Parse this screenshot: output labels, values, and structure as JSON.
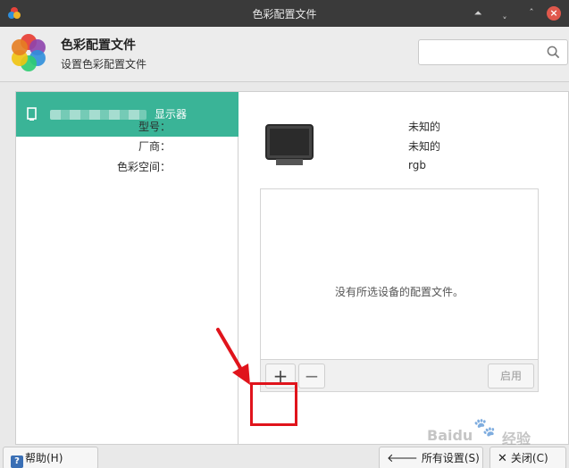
{
  "window": {
    "title": "色彩配置文件"
  },
  "header": {
    "title": "色彩配置文件",
    "subtitle": "设置色彩配置文件"
  },
  "search": {
    "placeholder": "",
    "value": ""
  },
  "devices": [
    {
      "label": "显示器",
      "selected": true
    }
  ],
  "details": {
    "fields": [
      {
        "key": "型号：",
        "value": "未知的"
      },
      {
        "key": "厂商：",
        "value": "未知的"
      },
      {
        "key": "色彩空间：",
        "value": "rgb"
      }
    ],
    "empty_message": "没有所选设备的配置文件。",
    "toolbar": {
      "add_label": "+",
      "remove_label": "−",
      "enable_label": "启用"
    }
  },
  "footer": {
    "help_label": "帮助(H)",
    "help_icon_text": "?",
    "all_settings_label": "所有设置(S)",
    "close_label": "关闭(C)"
  },
  "watermark": {
    "text": "Baidu",
    "suffix": "经验"
  },
  "colors": {
    "accent": "#3ab497",
    "highlight": "#e0141c",
    "titlebar": "#3a3a3a"
  },
  "icons": [
    "app-icon",
    "shade-icon",
    "minimize-icon",
    "maximize-icon",
    "close-icon",
    "search-icon",
    "monitor-icon",
    "display-icon",
    "help-icon",
    "arrow-left-icon",
    "close-x-icon"
  ]
}
